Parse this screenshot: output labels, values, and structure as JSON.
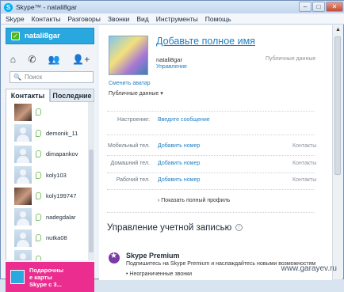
{
  "window": {
    "title": "Skype™ - natali8gar"
  },
  "menu": [
    "Skype",
    "Контакты",
    "Разговоры",
    "Звонки",
    "Вид",
    "Инструменты",
    "Помощь"
  ],
  "sidebar": {
    "status_name": "natali8gar",
    "search_placeholder": "Поиск",
    "tabs": [
      "Контакты",
      "Последние"
    ],
    "contacts": [
      "",
      "demonik_11",
      "dimapankov",
      "koly103",
      "koly199747",
      "nadegdalar",
      "nutka08",
      ""
    ],
    "ad_text_line1": "Подарочны",
    "ad_text_line2": "е карты",
    "ad_text_line3": "Skype с 3..."
  },
  "profile": {
    "full_name_link": "Добавьте полное имя",
    "username": "natali8gar",
    "public_data_label": "Публичные данные",
    "manage_link": "Управление",
    "change_avatar": "Сменить аватар",
    "public_dropdown": "Публичные данные ▾",
    "mood_label": "Настроение:",
    "mood_link": "Введите сообщение",
    "phones": [
      {
        "label": "Мобильный тел.",
        "link": "Добавить номер",
        "right": "Контакты"
      },
      {
        "label": "Домашний тел.",
        "link": "Добавить номер",
        "right": "Контакты"
      },
      {
        "label": "Рабочий тел.",
        "link": "Добавить номер",
        "right": "Контакты"
      }
    ],
    "show_full_profile": "› Показать полный профиль"
  },
  "account": {
    "title": "Управление учетной записью",
    "premium_title": "Skype Premium",
    "premium_desc": "Подпишитесь на Skype Premium и наслаждайтесь новыми возможностям",
    "premium_bullet": "• Неограниченные звонки"
  },
  "watermark": "www.garayev.ru"
}
